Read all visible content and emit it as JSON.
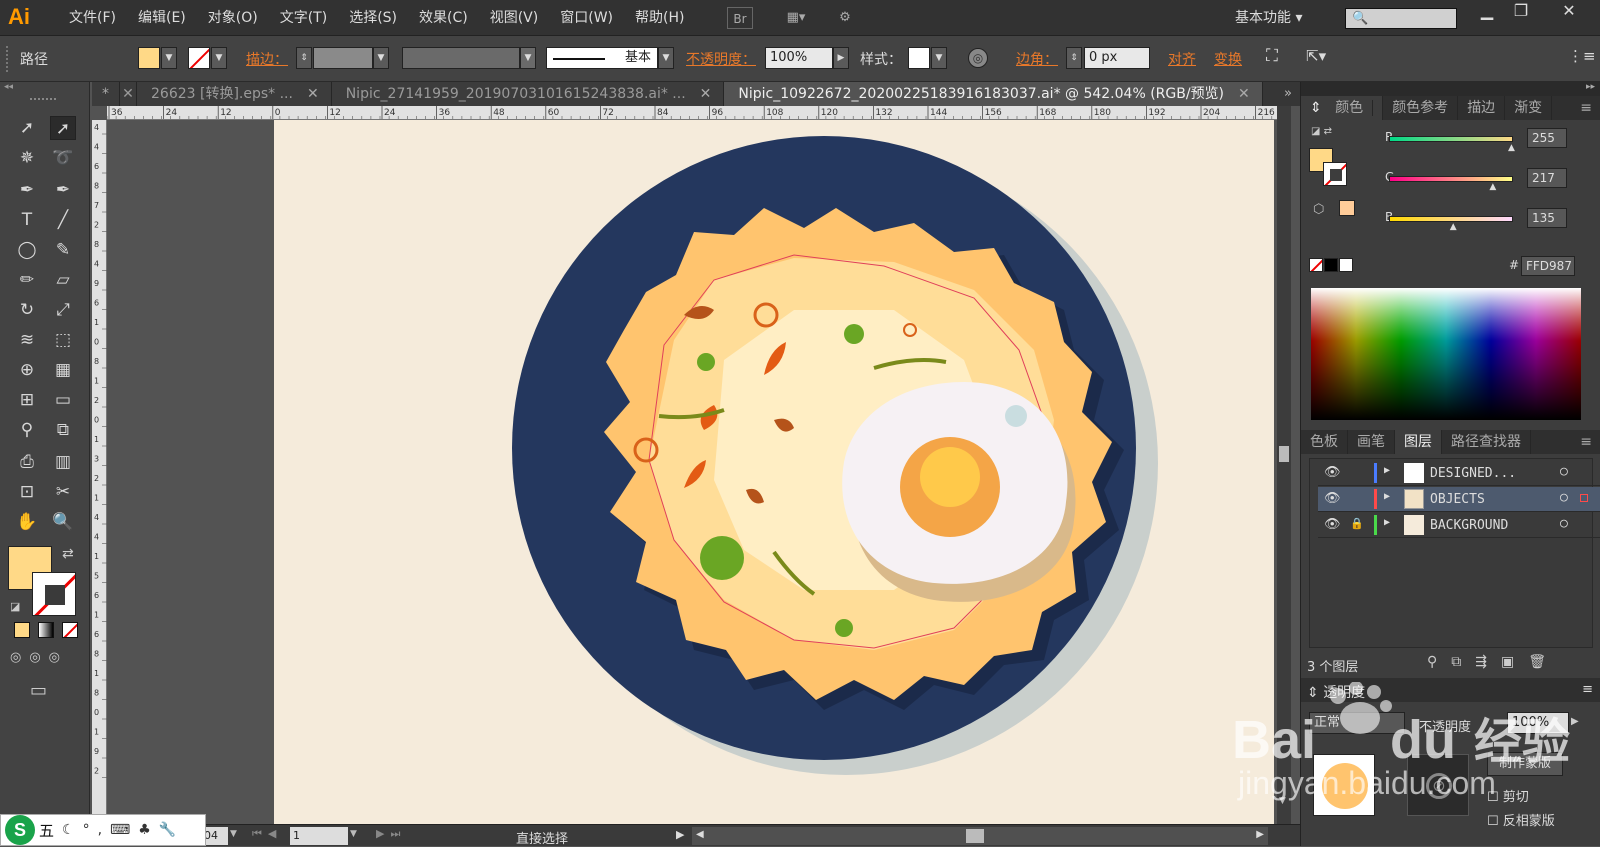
{
  "app": {
    "logo": "Ai",
    "workspace": "基本功能",
    "menus": [
      "文件(F)",
      "编辑(E)",
      "对象(O)",
      "文字(T)",
      "选择(S)",
      "效果(C)",
      "视图(V)",
      "窗口(W)",
      "帮助(H)"
    ],
    "bridge_label": "Br"
  },
  "control": {
    "object_type": "路径",
    "stroke_label": "描边：",
    "stroke_style": "基本",
    "opacity_label": "不透明度：",
    "opacity_value": "100%",
    "style_label": "样式：",
    "corner_label": "边角：",
    "corner_value": "0 px",
    "align_label": "对齐",
    "transform_label": "变换"
  },
  "tabs": [
    {
      "label": "26623 [转换].eps* ...",
      "active": false
    },
    {
      "label": "Nipic_27141959_20190703101615243838.ai* ...",
      "active": false
    },
    {
      "label": "Nipic_10922672_20200225183916183037.ai* @ 542.04% (RGB/预览)",
      "active": true
    }
  ],
  "ruler_h": [
    "36",
    "24",
    "12",
    "0",
    "12",
    "24",
    "36",
    "48",
    "60",
    "72",
    "84",
    "96",
    "108",
    "120",
    "132",
    "144",
    "156",
    "168",
    "180",
    "192",
    "204",
    "216"
  ],
  "ruler_v": [
    "4",
    "4",
    "6",
    "8",
    "7",
    "2",
    "8",
    "4",
    "9",
    "6",
    "1",
    "0",
    "8",
    "1",
    "2",
    "0",
    "1",
    "3",
    "2",
    "1",
    "4",
    "4",
    "1",
    "5",
    "6",
    "1",
    "6",
    "8",
    "1",
    "8",
    "0",
    "1",
    "9",
    "2"
  ],
  "status": {
    "zoom": "542.04%",
    "zoom_short": "04",
    "page": "1",
    "tool": "直接选择"
  },
  "color_panel": {
    "tabs": [
      "颜色",
      "颜色参考",
      "描边",
      "渐变"
    ],
    "r_label": "R",
    "g_label": "G",
    "b_label": "B",
    "r": "255",
    "g": "217",
    "b": "135",
    "hex_label": "#",
    "hex": "FFD987",
    "r_pct": 1.0,
    "g_pct": 0.85,
    "b_pct": 0.53,
    "fill_color": "#ffd987"
  },
  "layers_panel": {
    "tabs": [
      "色板",
      "画笔",
      "图层",
      "路径查找器"
    ],
    "layers": [
      {
        "name": "DESIGNED...",
        "color": "#4a7cff",
        "locked": false,
        "selected": false
      },
      {
        "name": "OBJECTS",
        "color": "#ff4a4a",
        "locked": false,
        "selected": true
      },
      {
        "name": "BACKGROUND",
        "color": "#4ad94a",
        "locked": true,
        "selected": false
      }
    ],
    "count": "3 个图层"
  },
  "transparency_panel": {
    "title": "透明度",
    "mode": "正常",
    "opacity_label": "不透明度",
    "opacity": "100%",
    "make_mask": "制作蒙版",
    "clip": "剪切",
    "invert": "反相蒙版"
  },
  "ime": {
    "label": "五"
  },
  "watermark": {
    "brand": "Bai",
    "brand_end": "经验",
    "url": "jingyan.baidu.com"
  }
}
